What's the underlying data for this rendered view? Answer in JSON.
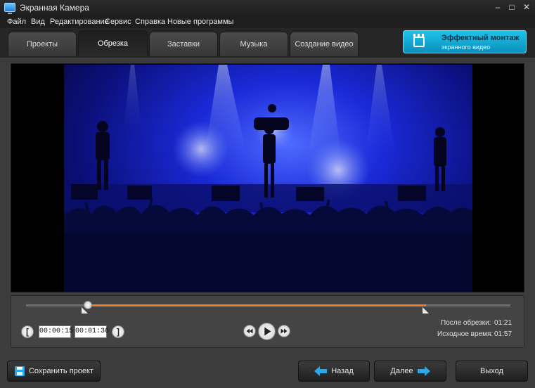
{
  "window": {
    "title": "Экранная Камера"
  },
  "menu": [
    "Файл",
    "Вид",
    "Редактирование",
    "Сервис",
    "Справка",
    "Новые программы"
  ],
  "tabs": [
    {
      "label": "Проекты",
      "active": false
    },
    {
      "label": "Обрезка",
      "active": true
    },
    {
      "label": "Заставки",
      "active": false
    },
    {
      "label": "Музыка",
      "active": false
    },
    {
      "label": "Создание видео",
      "active": false
    }
  ],
  "promo": {
    "title": "Эффектный монтаж",
    "subtitle": "экранного видео",
    "icon": "clapperboard-icon"
  },
  "trim": {
    "start_time": "00:00:15",
    "end_time": "00:01:36",
    "selection_start_fraction": 0.13,
    "selection_end_fraction": 0.83,
    "after_trim_label": "После обрезки:",
    "after_trim_value": "01:21",
    "original_label": "Исходное время:",
    "original_value": "01:57",
    "accent_color": "#f07a2b"
  },
  "bottom": {
    "save_label": "Сохранить проект",
    "back_label": "Назад",
    "next_label": "Далее",
    "exit_label": "Выход",
    "arrow_color": "#2ea8e8"
  }
}
